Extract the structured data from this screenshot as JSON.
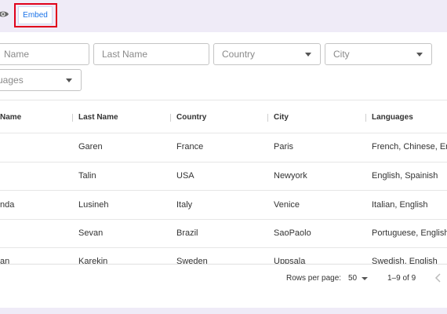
{
  "toolbar": {
    "view_icon": "eye-icon",
    "embed_label": "Embed",
    "highlight_color": "#e0001b",
    "accent_color": "#1a73e8"
  },
  "filters": {
    "first_name_placeholder": "Name",
    "last_name_placeholder": "Last Name",
    "country_placeholder": "Country",
    "city_placeholder": "City",
    "languages_placeholder": "uages"
  },
  "table": {
    "columns": [
      "Name",
      "Last Name",
      "Country",
      "City",
      "Languages"
    ],
    "rows": [
      {
        "name": "",
        "last_name": "Garen",
        "country": "France",
        "city": "Paris",
        "languages": "French, Chinese, Er"
      },
      {
        "name": "",
        "last_name": "Talin",
        "country": "USA",
        "city": "Newyork",
        "languages": "English, Spainish"
      },
      {
        "name": "nda",
        "last_name": "Lusineh",
        "country": "Italy",
        "city": "Venice",
        "languages": "Italian, English"
      },
      {
        "name": "",
        "last_name": "Sevan",
        "country": "Brazil",
        "city": "SaoPaolo",
        "languages": "Portuguese, English"
      },
      {
        "name": "an",
        "last_name": "Karekin",
        "country": "Sweden",
        "city": "Uppsala",
        "languages": "Swedish, English"
      }
    ]
  },
  "pagination": {
    "rows_per_page_label": "Rows per page:",
    "rows_per_page_value": "50",
    "range": "1–9 of 9"
  }
}
